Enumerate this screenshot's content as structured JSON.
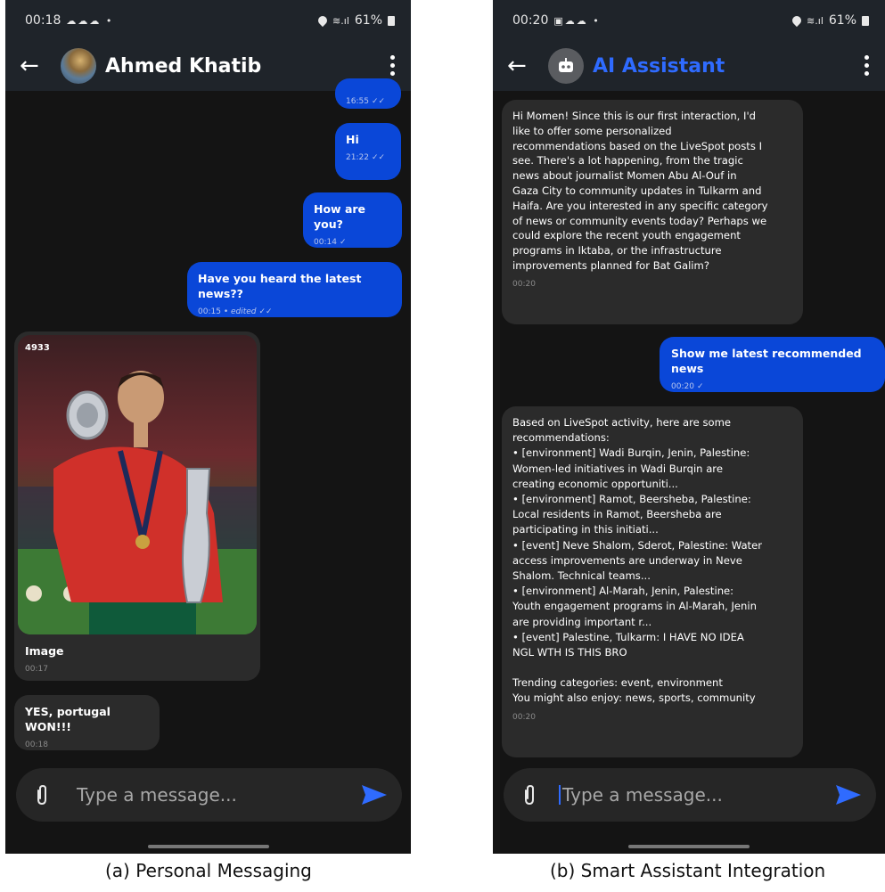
{
  "panel_a": {
    "status": {
      "time": "00:18",
      "battery": "61%"
    },
    "header": {
      "title": "Ahmed Khatib"
    },
    "messages": {
      "partial_time": "16:55",
      "m1": {
        "text": "Hi",
        "time": "21:22"
      },
      "m2": {
        "text": "How are you?",
        "time": "00:14"
      },
      "m3": {
        "text": "Have you heard the latest news??",
        "time": "00:15",
        "edited": "• edited"
      },
      "image_msg": {
        "label": "Image",
        "time": "00:17",
        "watermark": "4933"
      },
      "m5": {
        "text": "YES, portugal WON!!!",
        "time": "00:18"
      }
    },
    "input": {
      "placeholder": "Type a message..."
    },
    "caption": "(a) Personal Messaging"
  },
  "panel_b": {
    "status": {
      "time": "00:20",
      "battery": "61%"
    },
    "header": {
      "title": "AI Assistant"
    },
    "messages": {
      "m1": {
        "lines": [
          "Hi Momen! Since this is our first interaction, I'd",
          "like to offer some personalized",
          "recommendations based on the LiveSpot posts I",
          "see. There's a lot happening, from the tragic",
          "news about journalist Momen Abu Al-Ouf in",
          "Gaza City to community updates in Tulkarm and",
          "Haifa. Are you interested in any specific category",
          "of news or community events today? Perhaps we",
          "could explore the recent youth engagement",
          "programs in Iktaba, or the infrastructure",
          "improvements planned for Bat Galim?"
        ],
        "time": "00:20"
      },
      "m2": {
        "text": "Show me latest recommended news",
        "time": "00:20"
      },
      "m3": {
        "lines": [
          "Based on LiveSpot activity, here are some",
          "recommendations:",
          "• [environment] Wadi Burqin, Jenin, Palestine:",
          "Women-led initiatives in Wadi Burqin are",
          "creating economic opportuniti...",
          "• [environment] Ramot, Beersheba, Palestine:",
          "Local residents in Ramot, Beersheba are",
          "participating in this initiati...",
          "• [event] Neve Shalom, Sderot, Palestine: Water",
          "access improvements are underway in Neve",
          "Shalom. Technical teams...",
          "• [environment] Al-Marah, Jenin, Palestine:",
          "Youth engagement programs in Al-Marah, Jenin",
          "are providing important r...",
          "• [event] Palestine, Tulkarm: I HAVE NO IDEA",
          "NGL WTH IS THIS BRO",
          "",
          "Trending categories: event, environment",
          "You might also enjoy: news, sports, community"
        ],
        "time": "00:20"
      }
    },
    "input": {
      "placeholder": "Type a message..."
    },
    "caption": "(b) Smart Assistant Integration"
  },
  "colors": {
    "bubble_out": "#0a47d8",
    "bubble_in": "#2b2b2b",
    "accent_title_b": "#2f6bff",
    "send": "#2f6bff"
  }
}
